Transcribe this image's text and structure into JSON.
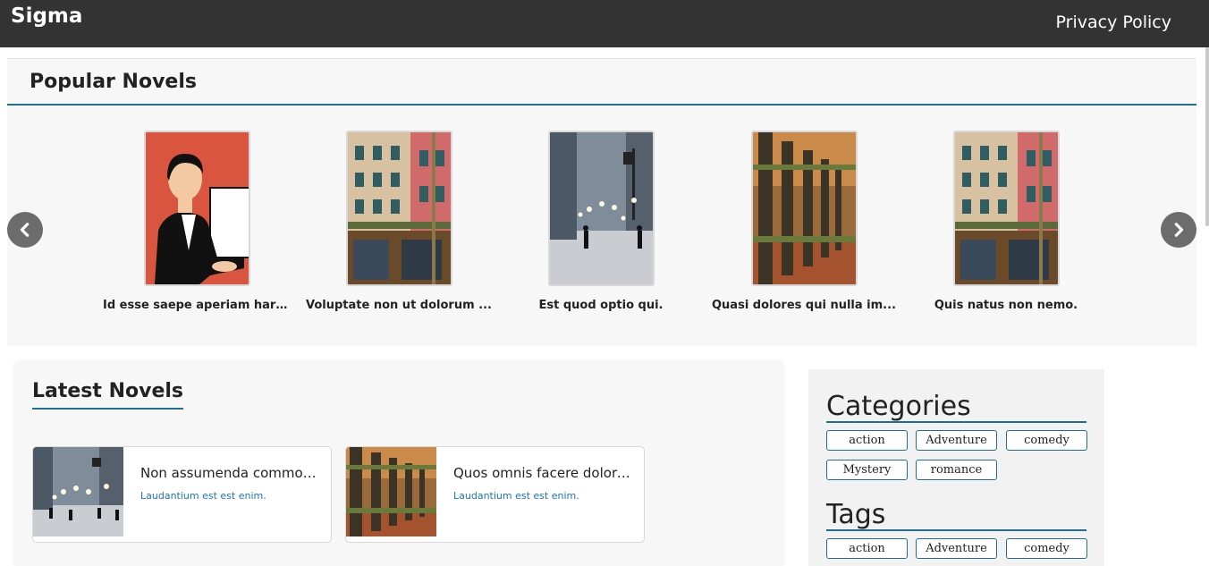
{
  "header": {
    "brand": "Sigma",
    "privacy_link": "Privacy Policy"
  },
  "popular": {
    "title": "Popular Novels",
    "items": [
      {
        "title": "Id esse saepe aperiam haru...",
        "cover": "businesswoman"
      },
      {
        "title": "Voluptate non ut dolorum ...",
        "cover": "city-building"
      },
      {
        "title": "Est quod optio qui.",
        "cover": "snowy-street"
      },
      {
        "title": "Quasi dolores qui nulla im...",
        "cover": "wooden-fence"
      },
      {
        "title": "Quis natus non nemo.",
        "cover": "city-building"
      }
    ]
  },
  "latest": {
    "title": "Latest Novels",
    "items": [
      {
        "title": "Non assumenda commodi...",
        "subtitle": "Laudantium est est enim.",
        "cover": "snowy-street"
      },
      {
        "title": "Quos omnis facere dolorem.",
        "subtitle": "Laudantium est est enim.",
        "cover": "wooden-fence"
      }
    ]
  },
  "sidebar": {
    "categories_title": "Categories",
    "categories": [
      "action",
      "Adventure",
      "comedy",
      "Mystery",
      "romance"
    ],
    "tags_title": "Tags",
    "tags": [
      "action",
      "Adventure",
      "comedy"
    ]
  },
  "colors": {
    "accent": "#1f6f95",
    "link": "#1f73b7",
    "topbar": "#333333"
  }
}
